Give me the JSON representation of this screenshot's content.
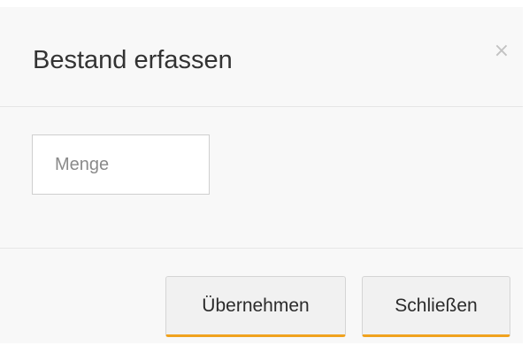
{
  "dialog": {
    "title": "Bestand erfassen",
    "close_icon": "×"
  },
  "form": {
    "quantity_placeholder": "Menge",
    "quantity_value": ""
  },
  "footer": {
    "apply_label": "Übernehmen",
    "close_label": "Schließen"
  },
  "colors": {
    "accent": "#f0a21e",
    "dialog_background": "#f8f8f8",
    "divider": "#e6e6e6"
  },
  "icons": {
    "close": "close-icon"
  }
}
